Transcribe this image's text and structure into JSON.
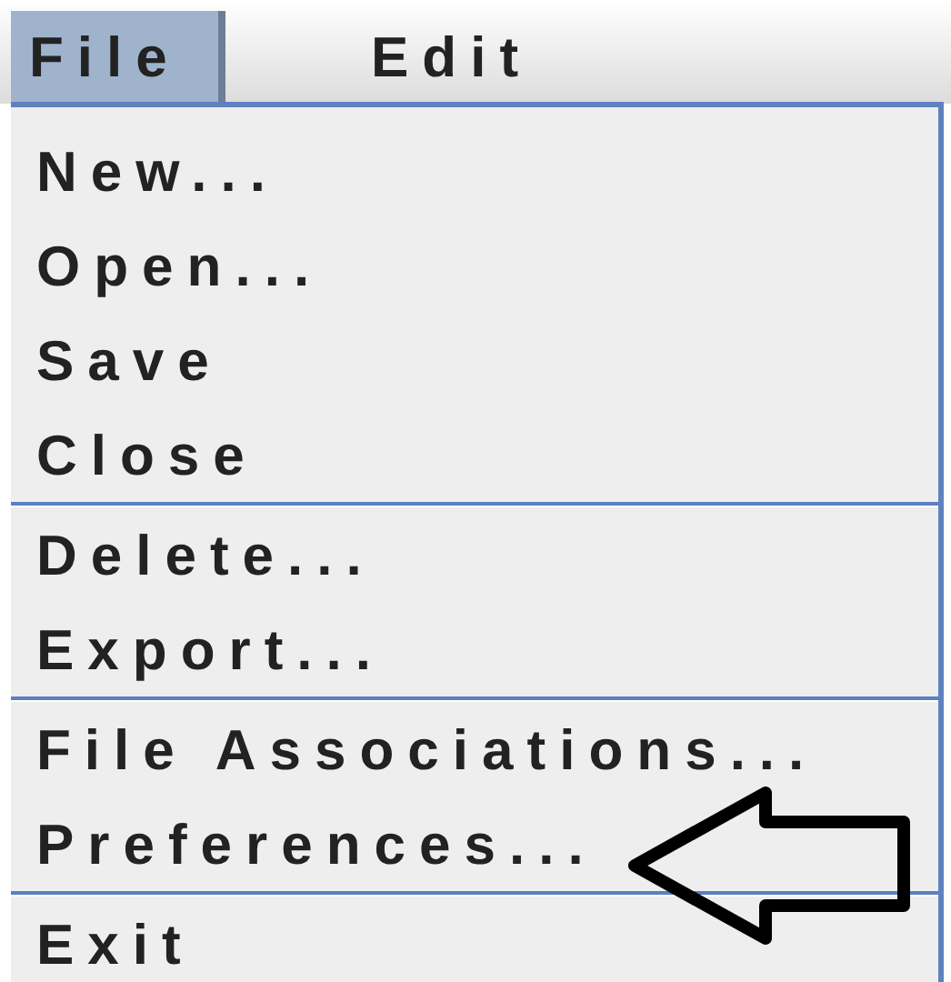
{
  "menubar": [
    {
      "label": "File",
      "selected": true
    },
    {
      "label": "Edit",
      "selected": false
    }
  ],
  "menu": {
    "groups": [
      [
        {
          "label": "New..."
        },
        {
          "label": "Open..."
        },
        {
          "label": "Save"
        },
        {
          "label": "Close"
        }
      ],
      [
        {
          "label": "Delete..."
        },
        {
          "label": "Export..."
        }
      ],
      [
        {
          "label": "File Associations..."
        },
        {
          "label": "Preferences...",
          "pointed": true
        }
      ],
      [
        {
          "label": "Exit"
        }
      ]
    ]
  }
}
